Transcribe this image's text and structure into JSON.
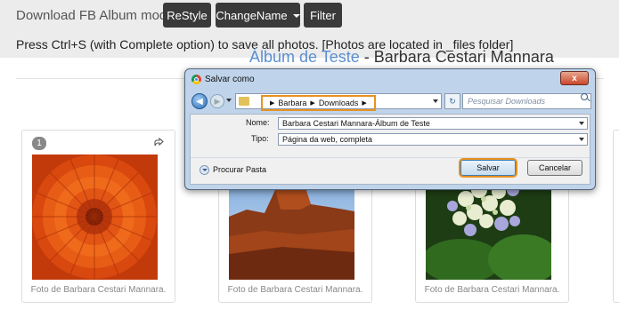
{
  "toolbar": {
    "brand": "Download FB Album mod",
    "restyle": "ReStyle",
    "changename": "ChangeName",
    "filter": "Filter",
    "notice": "Press Ctrl+S (with Complete option) to save all photos. [Photos are located in _files folder]"
  },
  "album": {
    "title_link": "Álbum de Teste",
    "title_sep": " - ",
    "title_owner": "Barbara Cestari Mannara"
  },
  "photos": [
    {
      "number": "1",
      "caption": "Foto de Barbara Cestari Mannara.",
      "icon": "share-icon"
    },
    {
      "caption": "Foto de Barbara Cestari Mannara."
    },
    {
      "caption": "Foto de Barbara Cestari Mannara."
    }
  ],
  "dialog": {
    "title": "Salvar como",
    "close": "x",
    "breadcrumb": [
      "Barbara",
      "Downloads"
    ],
    "search_placeholder": "Pesquisar Downloads",
    "name_label": "Nome:",
    "name_value": "Barbara Cestari Mannara-Álbum de Teste",
    "type_label": "Tipo:",
    "type_value": "Página da web, completa",
    "browse": "Procurar Pasta",
    "save": "Salvar",
    "cancel": "Cancelar"
  }
}
